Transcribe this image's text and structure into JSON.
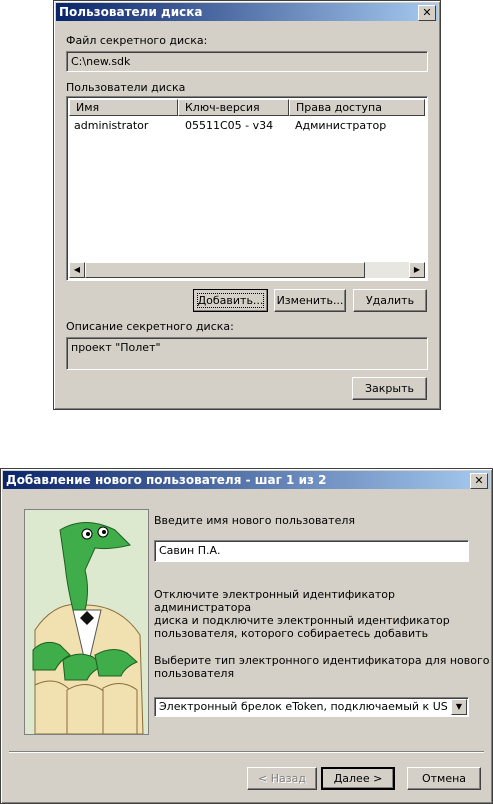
{
  "dialog1": {
    "title": "Пользователи диска",
    "close": "✕",
    "file_label": "Файл секретного диска:",
    "file_value": "C:\\new.sdk",
    "users_label": "Пользователи диска",
    "columns": [
      "Имя",
      "Ключ-версия",
      "Права доступа"
    ],
    "rows": [
      [
        "administrator",
        "05511C05 - v34",
        "Администратор"
      ]
    ],
    "buttons": {
      "add": "Добавить...",
      "edit": "Изменить...",
      "delete": "Удалить",
      "close": "Закрыть"
    },
    "desc_label": "Описание секретного диска:",
    "desc_value": "проект \"Полет\""
  },
  "dialog2": {
    "title": "Добавление нового пользователя - шаг 1 из 2",
    "close": "✕",
    "prompt_name": "Введите имя нового пользователя",
    "name_value": "Савин П.А.",
    "instruction": [
      "Отключите электронный идентификатор администратора",
      "диска и подключите электронный идентификатор",
      "пользователя, которого собираетесь добавить"
    ],
    "prompt_type": [
      "Выберите тип электронного идентификатора для нового",
      "пользователя"
    ],
    "type_value": "Электронный брелок eToken, подключаемый к USB-порту",
    "buttons": {
      "back": "< Назад",
      "next": "Далее >",
      "cancel": "Отмена"
    }
  }
}
